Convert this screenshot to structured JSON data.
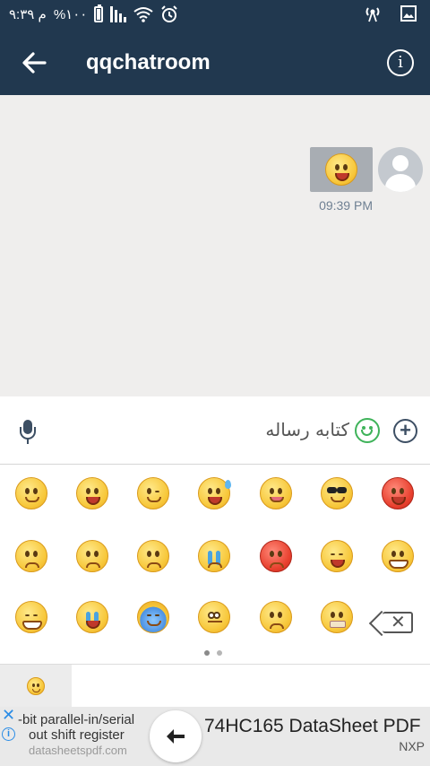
{
  "status_bar": {
    "time": "۹:۳۹ م",
    "battery": "%۱۰۰"
  },
  "app_bar": {
    "title": "qqchatroom",
    "info_glyph": "i"
  },
  "chat": {
    "messages": [
      {
        "from": "me",
        "content": "smile-emoji",
        "time": "09:39 PM"
      }
    ]
  },
  "composer": {
    "placeholder": "كتابه رساله"
  },
  "emoji_panel": {
    "rows": [
      [
        "smile",
        "grin-open",
        "wink-tongue",
        "laugh-sweat",
        "tongue",
        "cool",
        "angry-red"
      ],
      [
        "worried",
        "scared",
        "sad",
        "crying",
        "red-flush",
        "laugh",
        "grin-teeth"
      ],
      [
        "smirk",
        "sob",
        "sleepy",
        "stunned",
        "confused",
        "hushed",
        "backspace"
      ]
    ],
    "page_count": 2,
    "current_page": 1
  },
  "sticker_tabs": [
    {
      "icon": "smile-emoji",
      "selected": true
    }
  ],
  "ad": {
    "close_glyph": "✕",
    "info_glyph": "i",
    "line1": "-bit parallel-in/serial",
    "line2": "out shift register",
    "line3": "datasheetspdf.com",
    "headline": "74HC165 DataSheet PDF",
    "brand": "NXP",
    "arrow_glyph": "🡐"
  }
}
